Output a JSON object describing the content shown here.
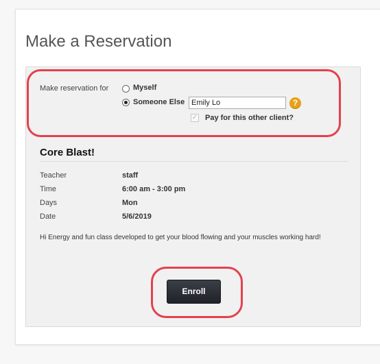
{
  "page": {
    "title": "Make a Reservation"
  },
  "reservation": {
    "label": "Make reservation for",
    "option_myself": "Myself",
    "option_someone_else": "Someone Else",
    "selected": "someone_else",
    "client_name": "Emily Lo",
    "help_icon": "question-mark",
    "pay_for_other_label": "Pay for this other client?",
    "pay_for_other_checked": true
  },
  "class": {
    "title": "Core Blast!",
    "details": [
      {
        "label": "Teacher",
        "value": "staff"
      },
      {
        "label": "Time",
        "value": "6:00 am - 3:00 pm"
      },
      {
        "label": "Days",
        "value": "Mon"
      },
      {
        "label": "Date",
        "value": "5/6/2019"
      }
    ],
    "description": "Hi Energy and fun class developed to get your blood flowing and your muscles working hard!"
  },
  "actions": {
    "enroll_label": "Enroll"
  },
  "colors": {
    "highlight": "#e3404e",
    "help_icon": "#e8a117",
    "button": "#2a2d33"
  }
}
